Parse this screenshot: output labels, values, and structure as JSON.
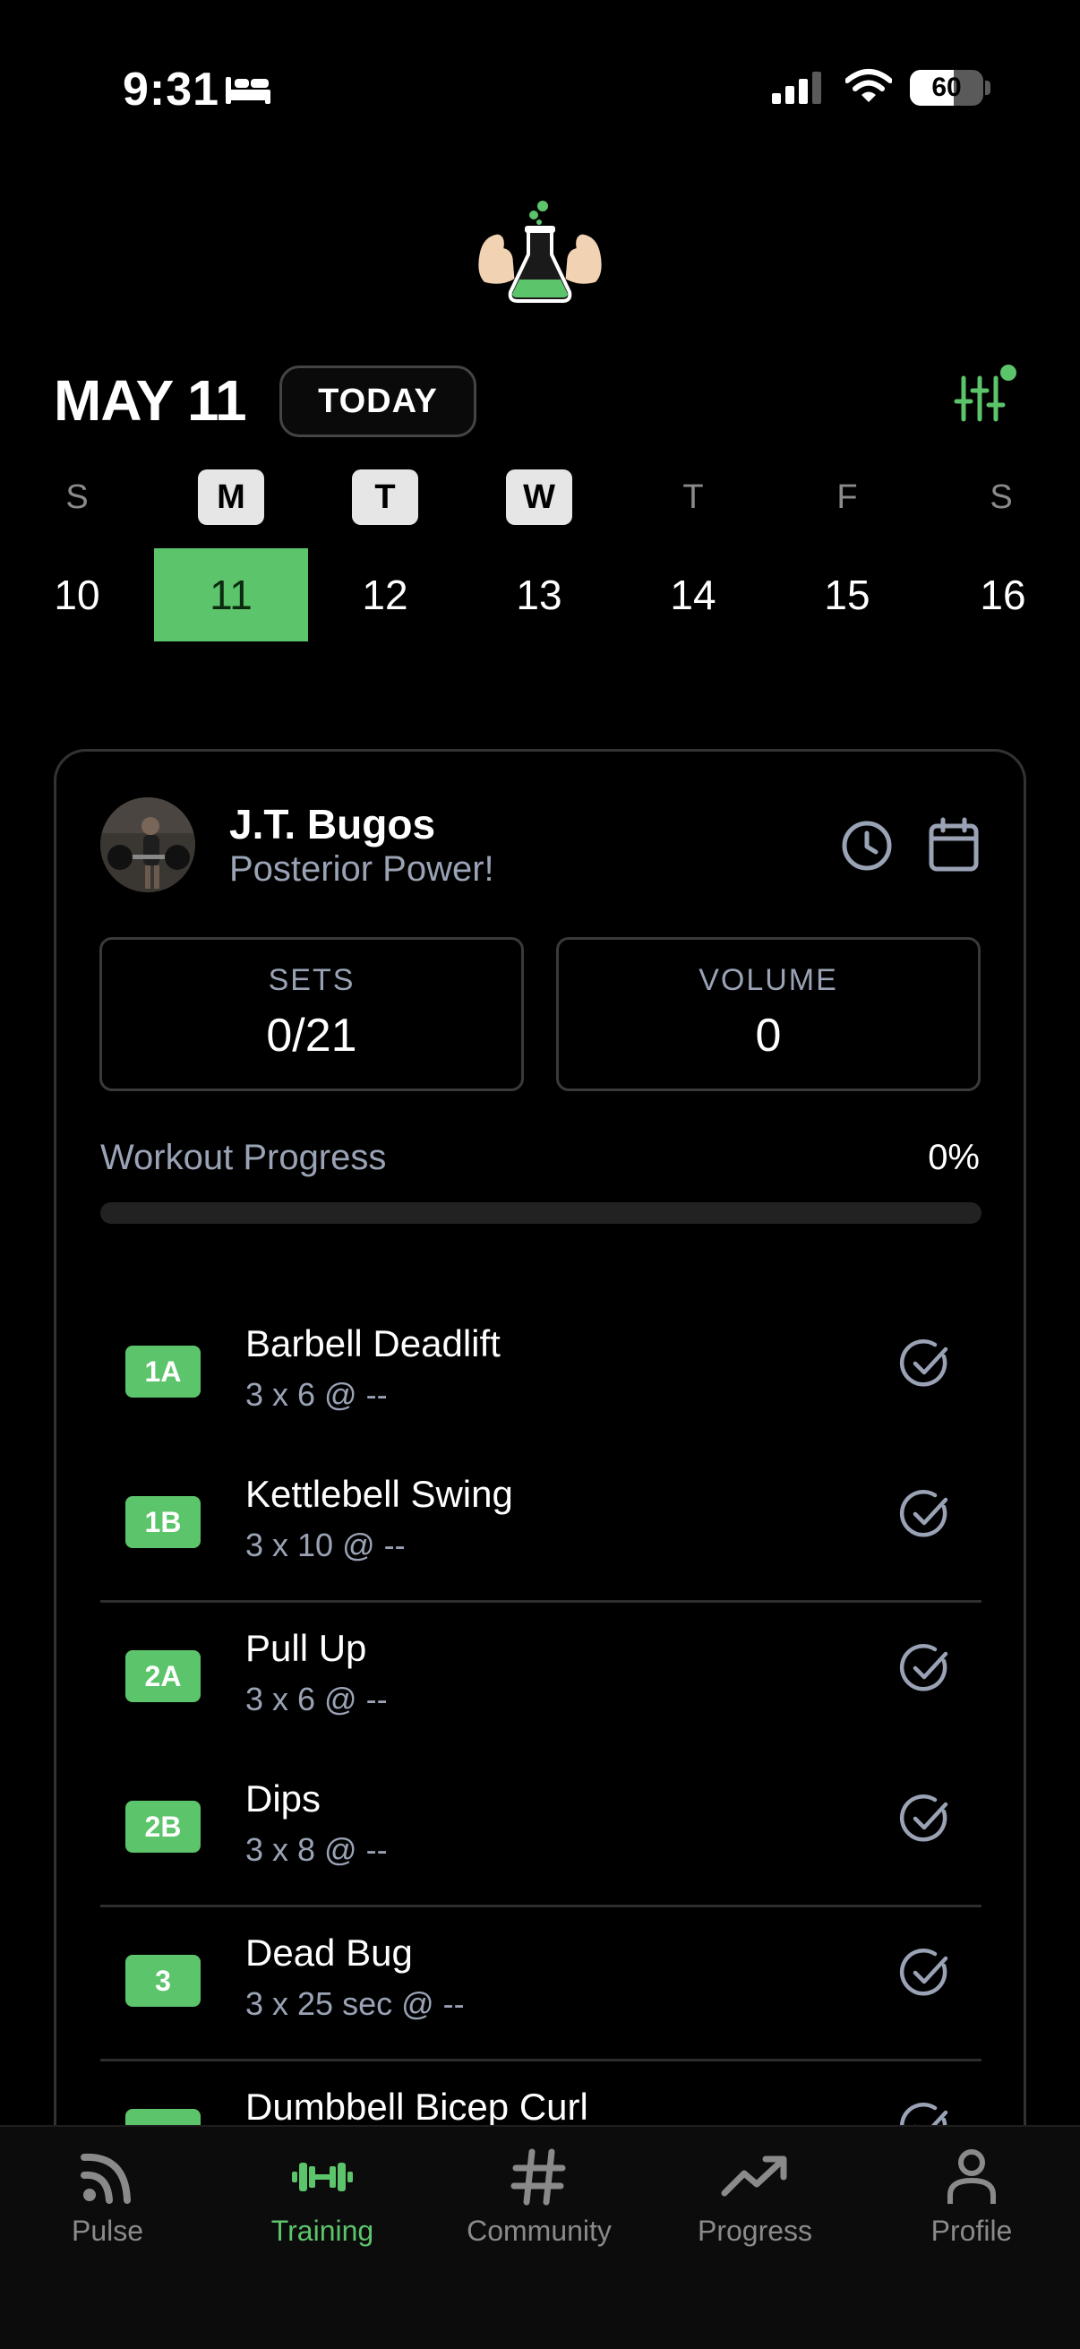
{
  "status_bar": {
    "time": "9:31",
    "battery": "60",
    "battery_fraction": 0.6
  },
  "header": {
    "date": "MAY 11",
    "today_label": "TODAY"
  },
  "week": {
    "weekdays": [
      {
        "letter": "S",
        "marked": false
      },
      {
        "letter": "M",
        "marked": true
      },
      {
        "letter": "T",
        "marked": true
      },
      {
        "letter": "W",
        "marked": true
      },
      {
        "letter": "T",
        "marked": false
      },
      {
        "letter": "F",
        "marked": false
      },
      {
        "letter": "S",
        "marked": false
      }
    ],
    "days": [
      "10",
      "11",
      "12",
      "13",
      "14",
      "15",
      "16"
    ],
    "selected_day": "11"
  },
  "workout": {
    "coach": "J.T. Bugos",
    "title": "Posterior Power!",
    "stats": {
      "sets_label": "SETS",
      "sets_value": "0/21",
      "volume_label": "VOLUME",
      "volume_value": "0"
    },
    "progress_label": "Workout Progress",
    "progress_pct": "0%",
    "progress_fraction": 0,
    "exercises": [
      {
        "badge": "1A",
        "name": "Barbell Deadlift",
        "detail": "3 x 6 @ --"
      },
      {
        "badge": "1B",
        "name": "Kettlebell Swing",
        "detail": "3 x 10 @ --"
      },
      {
        "badge": "2A",
        "name": "Pull Up",
        "detail": "3 x 6 @ --"
      },
      {
        "badge": "2B",
        "name": "Dips",
        "detail": "3 x 8 @ --"
      },
      {
        "badge": "3",
        "name": "Dead Bug",
        "detail": "3 x 25 sec @ --"
      },
      {
        "badge": "",
        "name": "Dumbbell Bicep Curl",
        "detail": ""
      }
    ]
  },
  "tabs": [
    {
      "label": "Pulse",
      "icon": "pulse-icon",
      "active": false
    },
    {
      "label": "Training",
      "icon": "dumbbell-icon",
      "active": true
    },
    {
      "label": "Community",
      "icon": "hashtag-icon",
      "active": false
    },
    {
      "label": "Progress",
      "icon": "trend-icon",
      "active": false
    },
    {
      "label": "Profile",
      "icon": "person-icon",
      "active": false
    }
  ],
  "colors": {
    "accent": "#5cc46a",
    "muted_text": "#9aa3b5",
    "background": "#000000"
  }
}
